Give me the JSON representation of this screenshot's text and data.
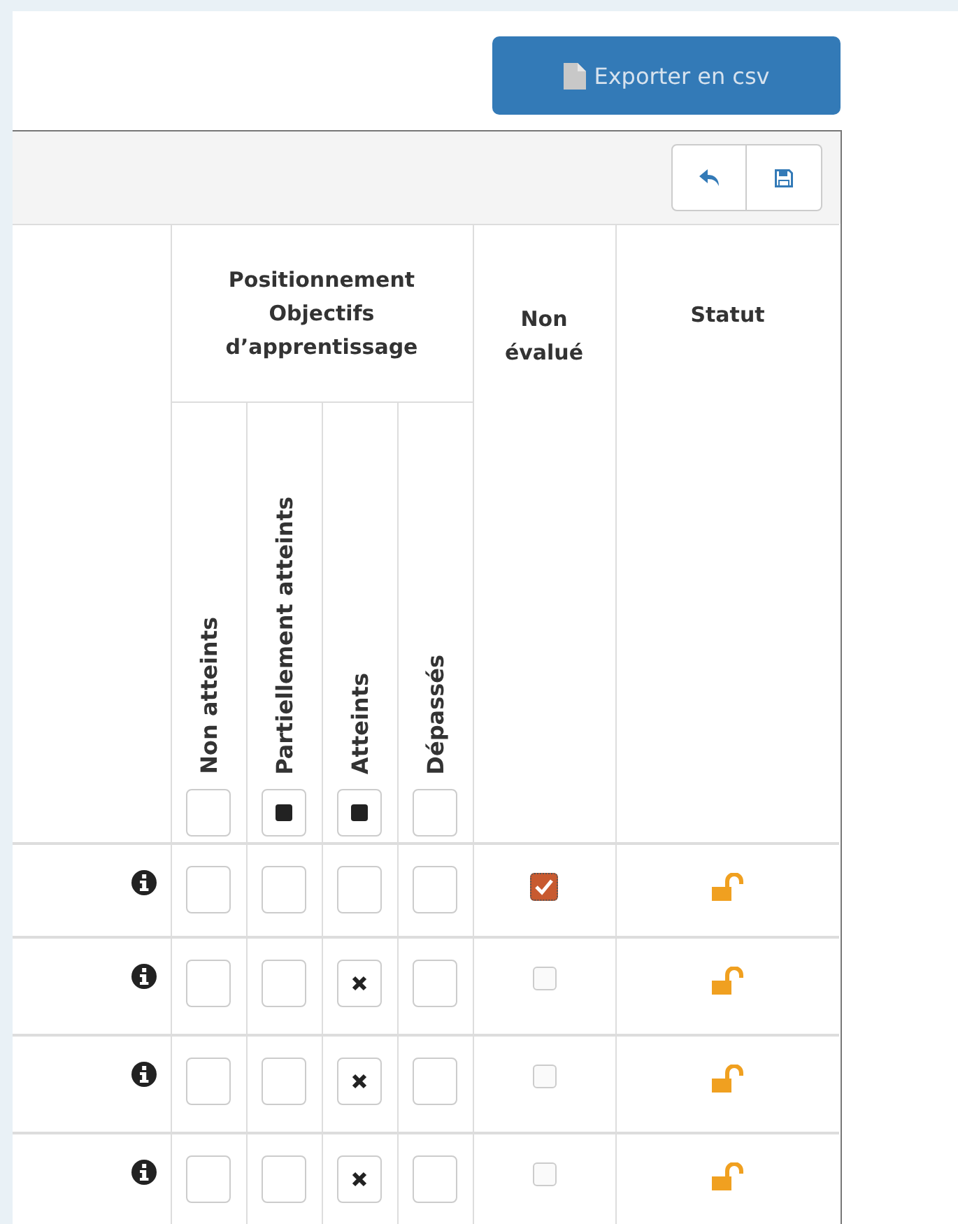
{
  "export_button": {
    "label": "Exporter en csv"
  },
  "table": {
    "group_header": "Positionnement Objectifs d’apprentissage",
    "columns": [
      {
        "label": "Non atteints",
        "filter_checked": false
      },
      {
        "label": "Partiellement atteints",
        "filter_checked": true
      },
      {
        "label": "Atteints",
        "filter_checked": true
      },
      {
        "label": "Dépassés",
        "filter_checked": false
      }
    ],
    "non_evaluated_header": "Non évalué",
    "status_header": "Statut",
    "rows": [
      {
        "marks": [
          false,
          false,
          false,
          false
        ],
        "non_evaluated": true,
        "locked": false
      },
      {
        "marks": [
          false,
          false,
          true,
          false
        ],
        "non_evaluated": false,
        "locked": false
      },
      {
        "marks": [
          false,
          false,
          true,
          false
        ],
        "non_evaluated": false,
        "locked": false
      },
      {
        "marks": [
          false,
          false,
          true,
          false
        ],
        "non_evaluated": false,
        "locked": false
      }
    ]
  }
}
